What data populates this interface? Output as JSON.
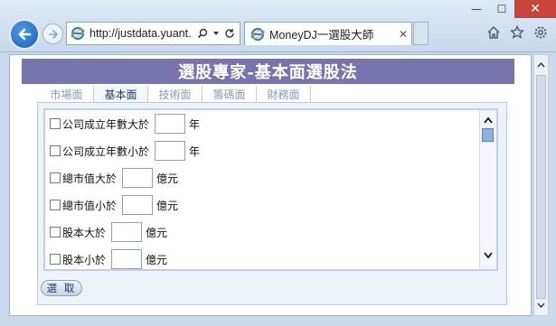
{
  "window": {
    "minimize_glyph": "—",
    "maximize_glyph": "☐",
    "close_glyph": "✕"
  },
  "browser": {
    "address": "http://justdata.yuant...",
    "address_icons": [
      "search-icon",
      "dropdown-icon",
      "refresh-icon"
    ],
    "tab_title": "MoneyDJ一選股大師",
    "tab_close": "✕",
    "tool_icons": [
      "home-icon",
      "favorites-icon",
      "settings-icon"
    ]
  },
  "page": {
    "header": "選股專家-基本面選股法",
    "tabs": [
      {
        "label": "市場面",
        "active": false
      },
      {
        "label": "基本面",
        "active": true
      },
      {
        "label": "技術面",
        "active": false
      },
      {
        "label": "籌碼面",
        "active": false
      },
      {
        "label": "財務面",
        "active": false
      }
    ],
    "criteria": [
      {
        "label": "公司成立年數大於",
        "unit": "年"
      },
      {
        "label": "公司成立年數小於",
        "unit": "年"
      },
      {
        "label": "總市值大於",
        "unit": "億元"
      },
      {
        "label": "總市值小於",
        "unit": "億元"
      },
      {
        "label": "股本大於",
        "unit": "億元"
      },
      {
        "label": "股本小於",
        "unit": "億元"
      }
    ],
    "submit_label": "選 取"
  },
  "colors": {
    "header_bg": "#7774ae",
    "close_button": "#c7453a",
    "back_button": "#1c5fb6"
  }
}
